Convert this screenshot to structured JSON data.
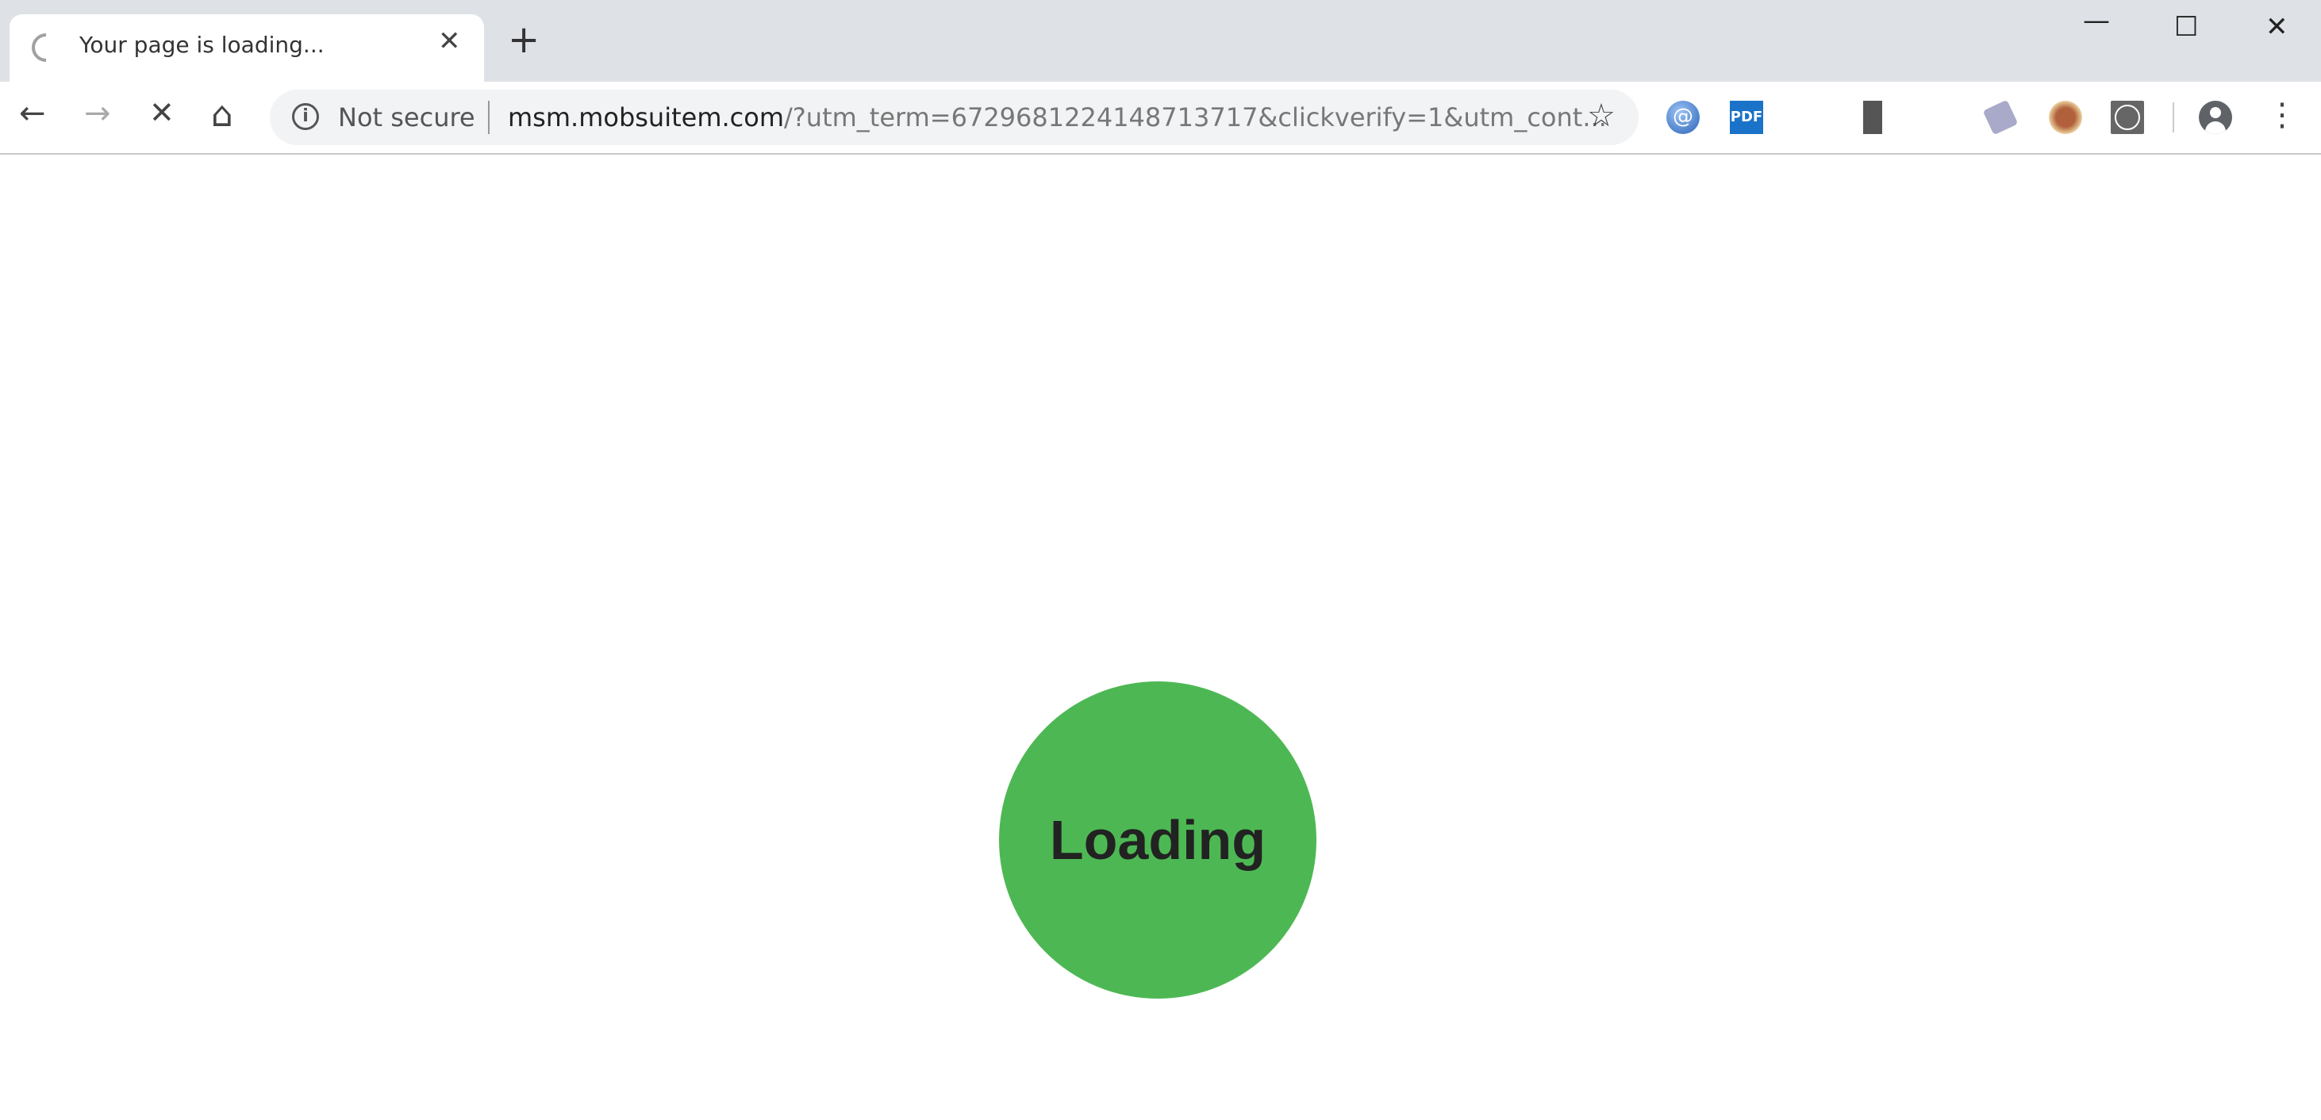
{
  "tab": {
    "title": "Your page is loading...",
    "close": "✕"
  },
  "new_tab": "+",
  "window_controls": {
    "minimize": "—",
    "maximize": "☐",
    "close": "✕"
  },
  "nav": {
    "back": "←",
    "forward": "→",
    "stop": "✕",
    "home": "⌂"
  },
  "omnibox": {
    "security": "Not secure",
    "url_host": "msm.mobsuitem.com",
    "url_rest": "/?utm_term=6729681224148713717&clickverify=1&utm_cont...",
    "star": "☆"
  },
  "extensions": [
    "email-extension",
    "pdf-extension",
    "movie-extension",
    "news-extension",
    "bag-extension",
    "search-extension"
  ],
  "extension_labels": {
    "pdf": "PDF"
  },
  "menu": "⋮",
  "page": {
    "loading_text": "Loading",
    "circle_color": "#4db853"
  }
}
